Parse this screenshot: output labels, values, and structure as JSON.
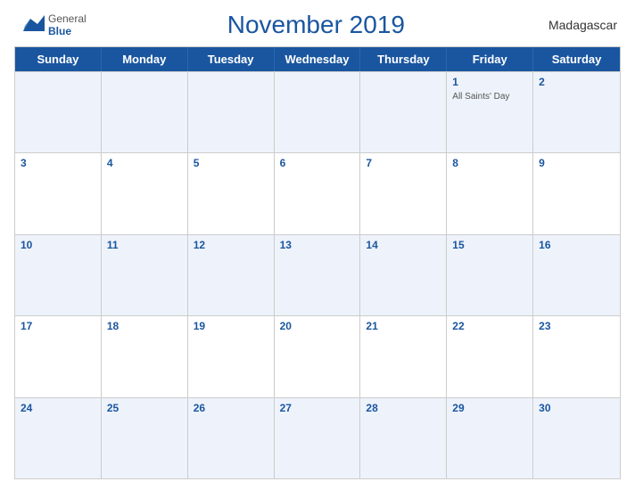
{
  "header": {
    "logo_general": "General",
    "logo_blue": "Blue",
    "title": "November 2019",
    "country": "Madagascar"
  },
  "days_of_week": [
    "Sunday",
    "Monday",
    "Tuesday",
    "Wednesday",
    "Thursday",
    "Friday",
    "Saturday"
  ],
  "weeks": [
    [
      {
        "day": "",
        "empty": true
      },
      {
        "day": "",
        "empty": true
      },
      {
        "day": "",
        "empty": true
      },
      {
        "day": "",
        "empty": true
      },
      {
        "day": "",
        "empty": true
      },
      {
        "day": "1",
        "event": "All Saints' Day"
      },
      {
        "day": "2",
        "event": ""
      }
    ],
    [
      {
        "day": "3",
        "event": ""
      },
      {
        "day": "4",
        "event": ""
      },
      {
        "day": "5",
        "event": ""
      },
      {
        "day": "6",
        "event": ""
      },
      {
        "day": "7",
        "event": ""
      },
      {
        "day": "8",
        "event": ""
      },
      {
        "day": "9",
        "event": ""
      }
    ],
    [
      {
        "day": "10",
        "event": ""
      },
      {
        "day": "11",
        "event": ""
      },
      {
        "day": "12",
        "event": ""
      },
      {
        "day": "13",
        "event": ""
      },
      {
        "day": "14",
        "event": ""
      },
      {
        "day": "15",
        "event": ""
      },
      {
        "day": "16",
        "event": ""
      }
    ],
    [
      {
        "day": "17",
        "event": ""
      },
      {
        "day": "18",
        "event": ""
      },
      {
        "day": "19",
        "event": ""
      },
      {
        "day": "20",
        "event": ""
      },
      {
        "day": "21",
        "event": ""
      },
      {
        "day": "22",
        "event": ""
      },
      {
        "day": "23",
        "event": ""
      }
    ],
    [
      {
        "day": "24",
        "event": ""
      },
      {
        "day": "25",
        "event": ""
      },
      {
        "day": "26",
        "event": ""
      },
      {
        "day": "27",
        "event": ""
      },
      {
        "day": "28",
        "event": ""
      },
      {
        "day": "29",
        "event": ""
      },
      {
        "day": "30",
        "event": ""
      }
    ]
  ],
  "colors": {
    "header_bg": "#1a56a0",
    "header_text": "#ffffff",
    "title_color": "#1a56a0",
    "day_number_color": "#1a56a0",
    "odd_row_bg": "#eef3fb",
    "even_row_bg": "#ffffff"
  }
}
